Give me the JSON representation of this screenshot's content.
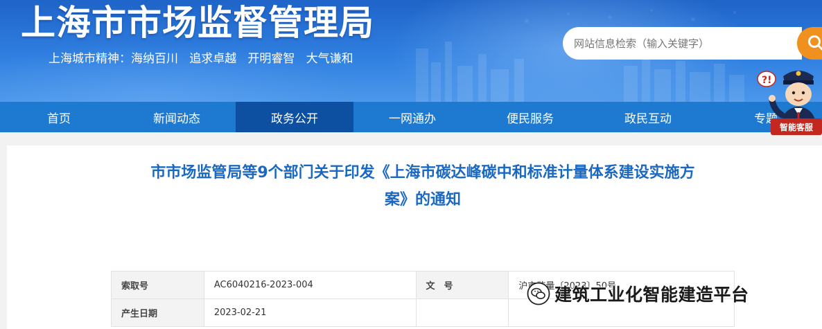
{
  "header": {
    "site_title": "上海市市场监督管理局",
    "slogan": "上海城市精神：海纳百川   追求卓越   开明睿智   大气谦和"
  },
  "search": {
    "placeholder": "网站信息检索（输入关键字）"
  },
  "nav": {
    "items": [
      {
        "label": "首页"
      },
      {
        "label": "新闻动态"
      },
      {
        "label": "政务公开"
      },
      {
        "label": "一网通办"
      },
      {
        "label": "便民服务"
      },
      {
        "label": "政民互动"
      },
      {
        "label": "专题"
      }
    ],
    "active_index": 2
  },
  "assistant": {
    "label": "智能客服"
  },
  "article": {
    "title_line1": "市市场监管局等9个部门关于印发《上海市碳达峰碳中和标准计量体系建设实施方",
    "title_line2": "案》的通知"
  },
  "meta": {
    "index_no_label": "索取号",
    "index_no_value": "AC6040216-2023-004",
    "doc_no_label": "文　号",
    "doc_no_value": "沪市监量〔2023〕50号",
    "date_label": "产生日期",
    "date_value": "2023-02-21"
  },
  "watermark": {
    "text": "建筑工业化智能建造平台"
  },
  "colors": {
    "nav_bg": "#1e7ad1",
    "nav_active": "#0d4fa0",
    "title_blue": "#1a68c2",
    "search_orange": "#f0901e",
    "robot_label_red": "#c2281f"
  }
}
